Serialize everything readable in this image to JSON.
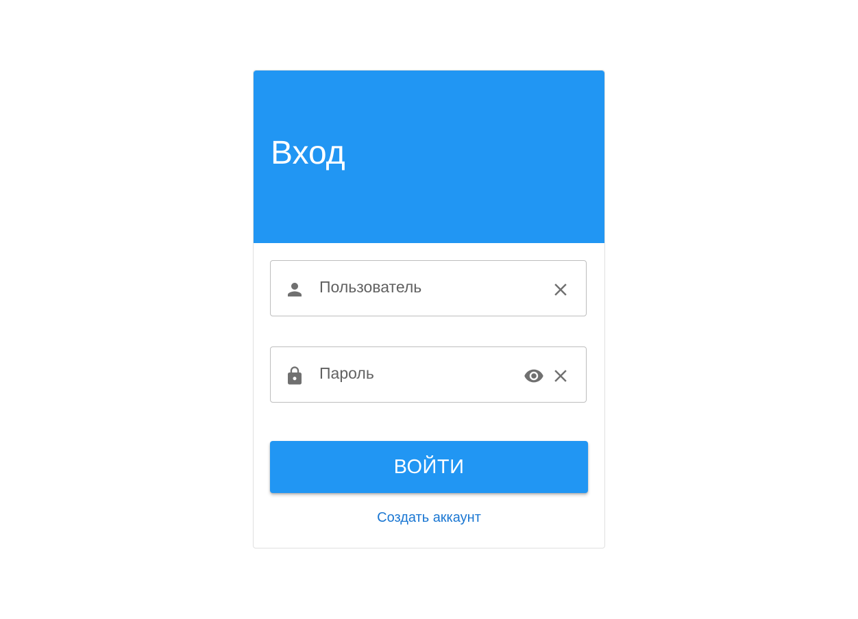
{
  "header": {
    "title": "Вход"
  },
  "username_field": {
    "placeholder": "Пользователь",
    "value": "",
    "icon": "person-icon",
    "trailing_icons": [
      "clear-icon"
    ]
  },
  "password_field": {
    "placeholder": "Пароль",
    "value": "",
    "icon": "lock-icon",
    "trailing_icons": [
      "eye-icon",
      "clear-icon"
    ]
  },
  "login_button": {
    "label": "ВОЙТИ"
  },
  "create_account_link": {
    "label": "Создать аккаунт"
  },
  "colors": {
    "primary": "#2196f3",
    "link": "#1976d2",
    "icon": "#707070",
    "border": "#bdbdbd"
  }
}
